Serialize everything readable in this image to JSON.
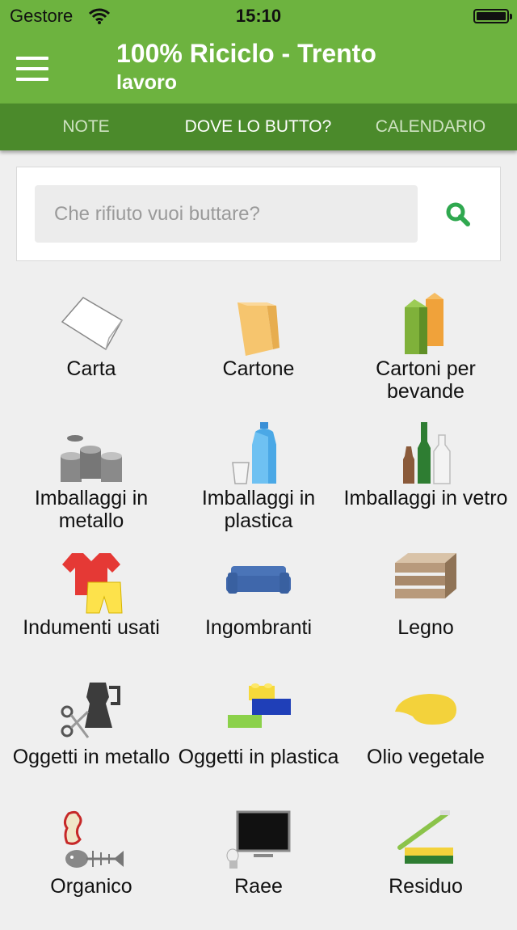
{
  "status_bar": {
    "carrier": "Gestore",
    "time": "15:10"
  },
  "header": {
    "title": "100% Riciclo - Trento",
    "subtitle": "lavoro"
  },
  "tabs": [
    {
      "label": "NOTE",
      "active": false
    },
    {
      "label": "DOVE LO BUTTO?",
      "active": true
    },
    {
      "label": "CALENDARIO",
      "active": false
    }
  ],
  "search": {
    "placeholder": "Che rifiuto vuoi buttare?",
    "value": ""
  },
  "categories": [
    {
      "label": "Carta",
      "icon": "paper-icon"
    },
    {
      "label": "Cartone",
      "icon": "cardboard-bag-icon"
    },
    {
      "label": "Cartoni per bevande",
      "icon": "drink-cartons-icon"
    },
    {
      "label": "Imballaggi in metallo",
      "icon": "metal-cans-icon"
    },
    {
      "label": "Imballaggi in plastica",
      "icon": "plastic-bottle-icon"
    },
    {
      "label": "Imballaggi in vetro",
      "icon": "glass-bottles-icon"
    },
    {
      "label": "Indumenti usati",
      "icon": "clothes-icon"
    },
    {
      "label": "Ingombranti",
      "icon": "sofa-icon"
    },
    {
      "label": "Legno",
      "icon": "wooden-crate-icon"
    },
    {
      "label": "Oggetti in metallo",
      "icon": "moka-scissors-icon"
    },
    {
      "label": "Oggetti in plastica",
      "icon": "plastic-bricks-icon"
    },
    {
      "label": "Olio vegetale",
      "icon": "oil-stain-icon"
    },
    {
      "label": "Organico",
      "icon": "apple-core-fishbone-icon"
    },
    {
      "label": "Raee",
      "icon": "monitor-bulb-icon"
    },
    {
      "label": "Residuo",
      "icon": "toothbrush-sponge-icon"
    }
  ],
  "colors": {
    "app_bar": "#6db33f",
    "tab_bar": "#4b8a2b",
    "search_icon": "#2fa84f",
    "background": "#efefef"
  }
}
